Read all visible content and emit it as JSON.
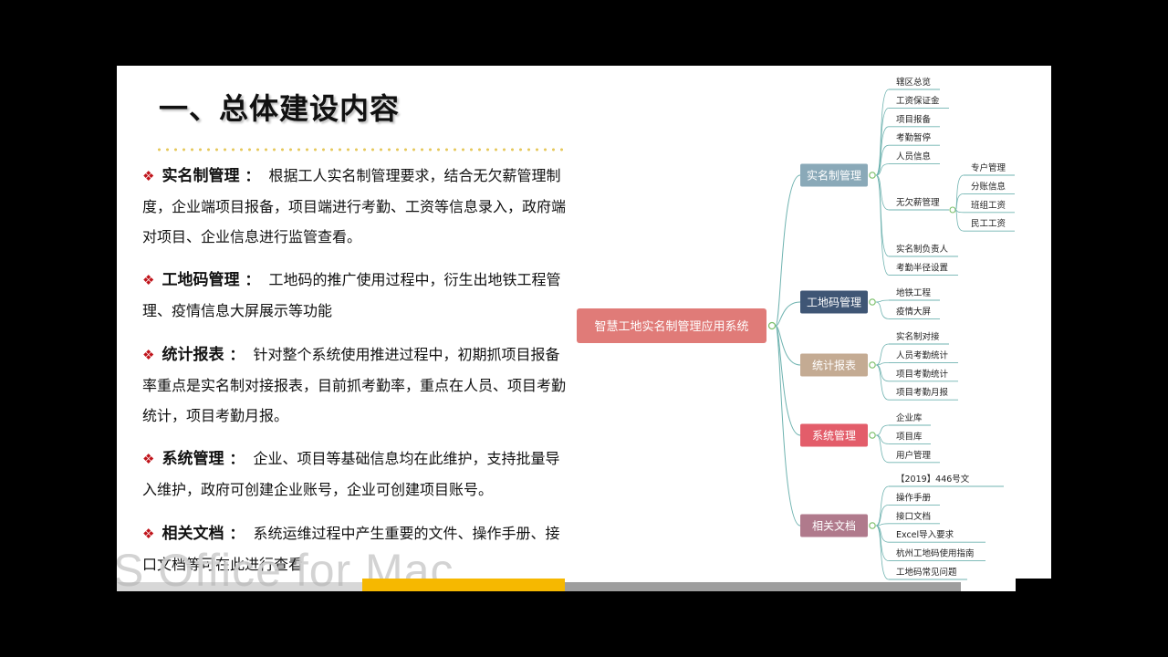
{
  "title": "一、总体建设内容",
  "watermark": "S Office for Mac",
  "sections": [
    {
      "head": "实名制管理",
      "colon": "：",
      "body": "根据工人实名制管理要求，结合无欠薪管理制度，企业端项目报备，项目端进行考勤、工资等信息录入，政府端对项目、企业信息进行监管查看。"
    },
    {
      "head": "工地码管理",
      "colon": "：",
      "body": "工地码的推广使用过程中，衍生出地铁工程管理、疫情信息大屏展示等功能"
    },
    {
      "head": "统计报表",
      "colon": "：",
      "body": "针对整个系统使用推进过程中，初期抓项目报备率重点是实名制对接报表，目前抓考勤率，重点在人员、项目考勤统计，项目考勤月报。"
    },
    {
      "head": "系统管理",
      "colon": "：",
      "body": "企业、项目等基础信息均在此维护，支持批量导入维护，政府可创建企业账号，企业可创建项目账号。"
    },
    {
      "head": "相关文档",
      "colon": "：",
      "body": "系统运维过程中产生重要的文件、操作手册、接口文档等可在此进行查看"
    }
  ],
  "mindmap": {
    "root": "智慧工地实名制管理应用系统",
    "branches": [
      {
        "label": "实名制管理",
        "color": "#8aa9b8",
        "children": [
          "辖区总览",
          "工资保证金",
          "项目报备",
          "考勤暂停",
          "人员信息",
          "无欠薪管理",
          "实名制负责人",
          "考勤半径设置"
        ],
        "sub": {
          "parent": "无欠薪管理",
          "children": [
            "专户管理",
            "分账信息",
            "班组工资",
            "民工工资"
          ]
        }
      },
      {
        "label": "工地码管理",
        "color": "#3f5675",
        "children": [
          "地铁工程",
          "疫情大屏"
        ]
      },
      {
        "label": "统计报表",
        "color": "#c4ab93",
        "children": [
          "实名制对接",
          "人员考勤统计",
          "项目考勤统计",
          "项目考勤月报"
        ]
      },
      {
        "label": "系统管理",
        "color": "#e35d6a",
        "children": [
          "企业库",
          "项目库",
          "用户管理"
        ]
      },
      {
        "label": "相关文档",
        "color": "#b07a8c",
        "children": [
          "【2019】446号文",
          "操作手册",
          "接口文档",
          "Excel导入要求",
          "杭州工地码使用指南",
          "工地码常见问题"
        ]
      }
    ],
    "root_color": "#e07b78"
  }
}
